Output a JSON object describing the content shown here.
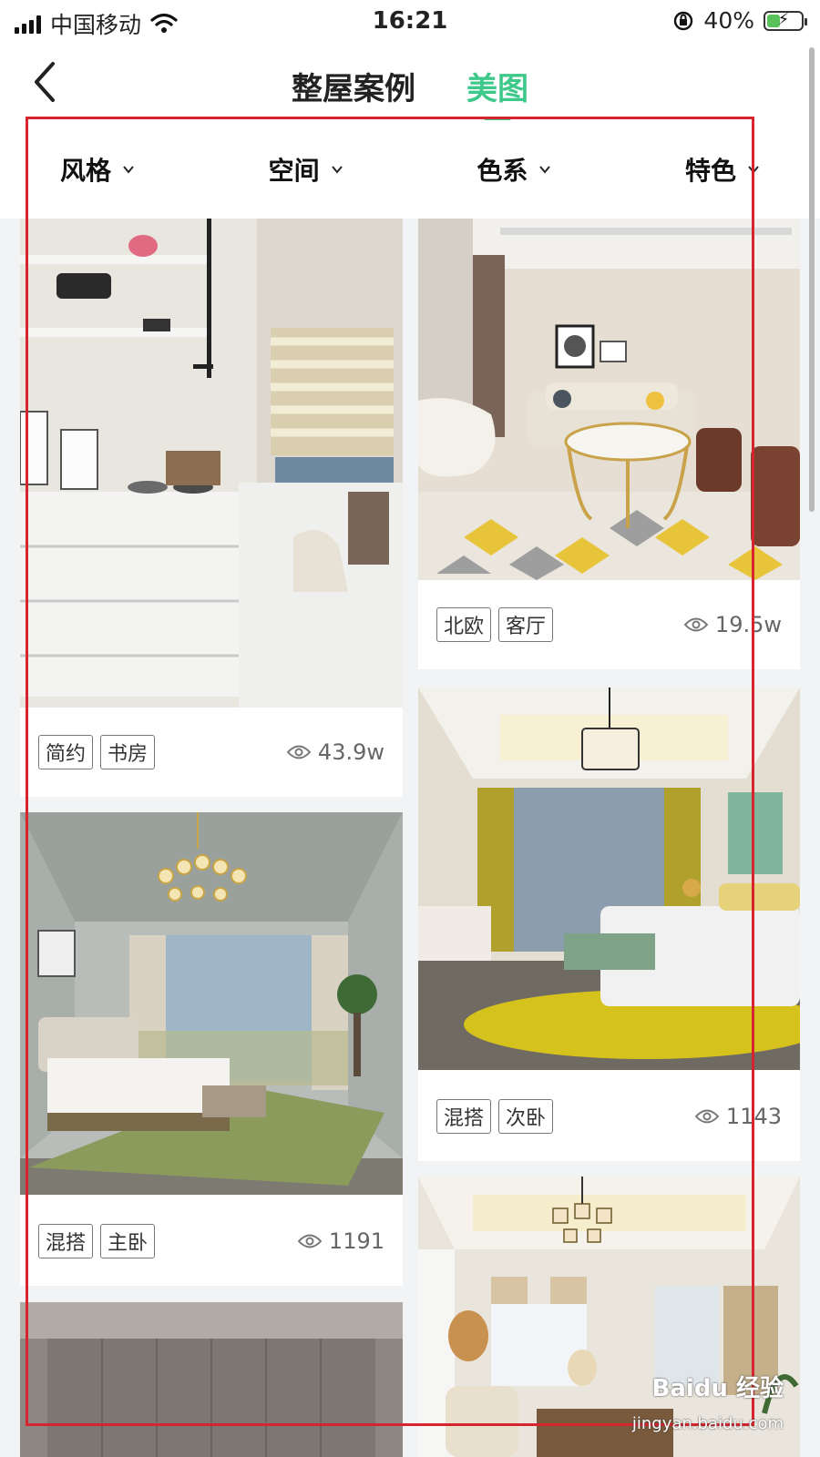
{
  "status_bar": {
    "carrier": "中国移动",
    "time": "16:21",
    "battery_percent": "40%",
    "battery_level": 0.4
  },
  "nav": {
    "tabs": [
      {
        "label": "整屋案例",
        "active": false
      },
      {
        "label": "美图",
        "active": true
      }
    ],
    "accent_color": "#3ec98a"
  },
  "filters": [
    {
      "label": "风格"
    },
    {
      "label": "空间"
    },
    {
      "label": "色系"
    },
    {
      "label": "特色"
    }
  ],
  "cards": [
    {
      "tags": [
        "简约",
        "书房"
      ],
      "views": "43.9w",
      "image": "study-room-photo"
    },
    {
      "tags": [
        "北欧",
        "客厅"
      ],
      "views": "19.5w",
      "image": "living-room-photo"
    },
    {
      "tags": [
        "混搭",
        "主卧"
      ],
      "views": "1191",
      "image": "master-bedroom-photo"
    },
    {
      "tags": [
        "混搭",
        "次卧"
      ],
      "views": "1143",
      "image": "second-bedroom-photo"
    },
    {
      "tags": [],
      "views": "",
      "image": "wardrobe-photo"
    },
    {
      "tags": [],
      "views": "",
      "image": "chandelier-bedroom-photo"
    }
  ],
  "watermark": {
    "logo": "Baidu 经验",
    "url": "jingyan.baidu.com"
  },
  "highlight_color": "#d6252e"
}
